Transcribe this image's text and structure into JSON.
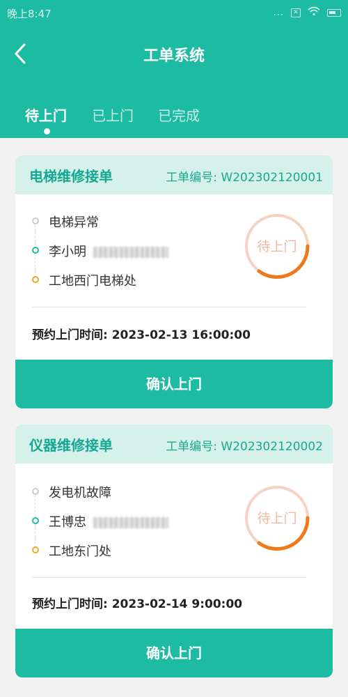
{
  "status_bar": {
    "time": "晚上8:47",
    "dots": "...",
    "sim": "✕"
  },
  "header": {
    "title": "工单系统"
  },
  "tabs": [
    {
      "label": "待上门",
      "active": true
    },
    {
      "label": "已上门",
      "active": false
    },
    {
      "label": "已完成",
      "active": false
    }
  ],
  "orders": [
    {
      "name": "电梯维修接单",
      "order_no": "工单编号: W202302120001",
      "issue": "电梯异常",
      "contact": "李小明",
      "location": "工地西门电梯处",
      "stamp": "待上门",
      "appointment": "预约上门时间: 2023-02-13 16:00:00",
      "button": "确认上门"
    },
    {
      "name": "仪器维修接单",
      "order_no": "工单编号: W202302120002",
      "issue": "发电机故障",
      "contact": "王博忠",
      "location": "工地东门处",
      "stamp": "待上门",
      "appointment": "预约上门时间: 2023-02-14 9:00:00",
      "button": "确认上门"
    }
  ],
  "colors": {
    "primary": "#1ebba3",
    "card_header": "#d6f0ea",
    "stamp_ring": "#f0c5b0",
    "stamp_arc": "#ef7a1c"
  },
  "icons": {
    "back": "chevron-left-icon",
    "wifi": "wifi-icon",
    "battery": "battery-icon",
    "sim": "sim-x-icon"
  }
}
